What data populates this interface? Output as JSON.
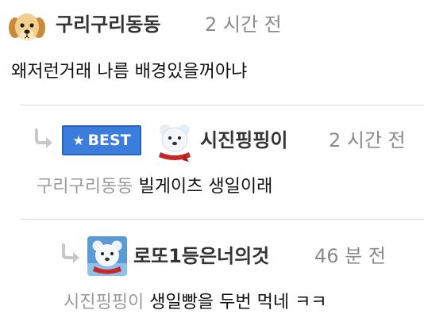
{
  "comments": [
    {
      "nickname": "구리구리동동",
      "time": "2 시간 전",
      "text": "왜저런거래 나름 배경있을꺼아냐",
      "avatar": "puppy-avatar"
    },
    {
      "badge": "BEST",
      "nickname": "시진핑핑이",
      "time": "2 시간 전",
      "mention": "구리구리동동",
      "text": "빌게이츠 생일이래",
      "avatar": "polar-bear-avatar"
    },
    {
      "nickname": "로또1등은너의것",
      "time": "46 분 전",
      "mention": "시진핑핑이",
      "text": "생일빵을 두번 먹네 ㅋㅋ",
      "avatar": "polar-bear-avatar"
    }
  ],
  "colors": {
    "best_badge": "#3b7ddd",
    "reply_arrow": "#c8c8c8",
    "mention": "#9a9a9a",
    "time": "#8a8a8a",
    "divider": "#d9d9d9"
  }
}
